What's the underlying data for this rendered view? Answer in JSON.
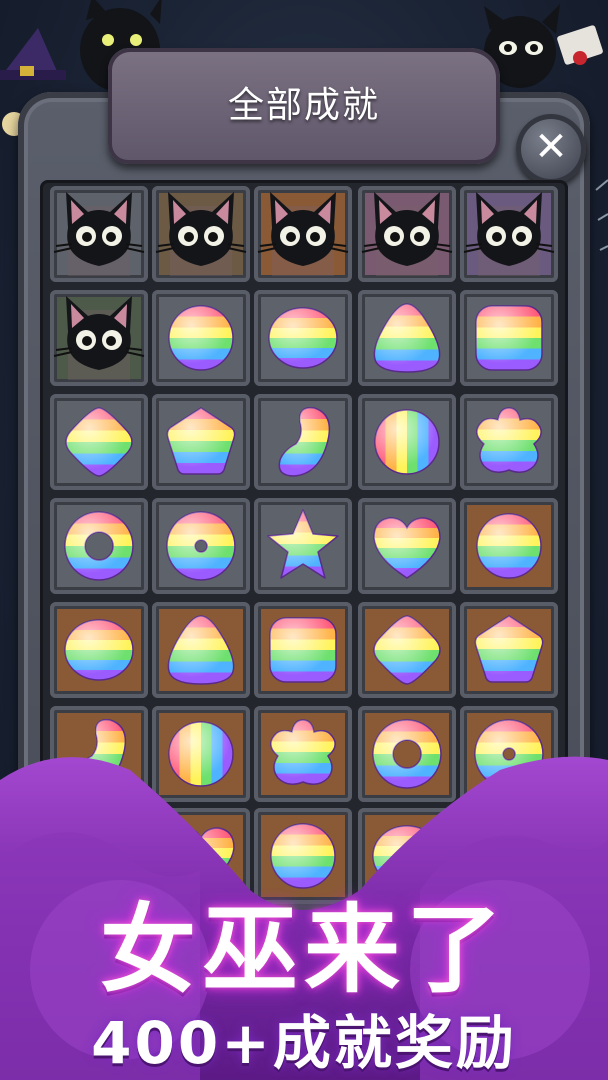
{
  "header": {
    "title": "全部成就",
    "close_label": "✕"
  },
  "banner": {
    "title": "女巫来了",
    "subtitle": "400+成就奖励"
  },
  "colors": {
    "tile_gray": "#5d626b",
    "tile_brown": "#8a5a36",
    "tile_pink": "#7a5a70",
    "tile_purple": "#6a5a80",
    "tile_green": "#4d5a4a",
    "mist_purple": "#8b3ab8"
  },
  "grid": {
    "rows": [
      [
        {
          "item": "cat-icon",
          "bg": "gray"
        },
        {
          "item": "cat-icon",
          "bg": "brown-dim"
        },
        {
          "item": "cat-icon",
          "bg": "brown"
        },
        {
          "item": "cat-icon",
          "bg": "pink"
        },
        {
          "item": "cat-icon",
          "bg": "purple"
        }
      ],
      [
        {
          "item": "cat-icon",
          "bg": "green"
        },
        {
          "item": "rainbow-ball-icon",
          "bg": "gray"
        },
        {
          "item": "rainbow-oval-icon",
          "bg": "gray"
        },
        {
          "item": "rainbow-triangle-icon",
          "bg": "gray"
        },
        {
          "item": "rainbow-square-icon",
          "bg": "gray"
        }
      ],
      [
        {
          "item": "rainbow-diamond-icon",
          "bg": "gray"
        },
        {
          "item": "rainbow-pentagon-icon",
          "bg": "gray"
        },
        {
          "item": "rainbow-moon-icon",
          "bg": "gray"
        },
        {
          "item": "rainbow-vertical-ball-icon",
          "bg": "gray"
        },
        {
          "item": "rainbow-flower-icon",
          "bg": "gray"
        }
      ],
      [
        {
          "item": "rainbow-ring-icon",
          "bg": "gray"
        },
        {
          "item": "rainbow-donut-icon",
          "bg": "gray"
        },
        {
          "item": "rainbow-star-icon",
          "bg": "gray"
        },
        {
          "item": "rainbow-heart-icon",
          "bg": "gray"
        },
        {
          "item": "rainbow-ball-icon",
          "bg": "brown"
        }
      ],
      [
        {
          "item": "rainbow-oval-icon",
          "bg": "brown"
        },
        {
          "item": "rainbow-triangle-icon",
          "bg": "brown"
        },
        {
          "item": "rainbow-square-icon",
          "bg": "brown"
        },
        {
          "item": "rainbow-diamond-icon",
          "bg": "brown"
        },
        {
          "item": "rainbow-pentagon-icon",
          "bg": "brown"
        }
      ],
      [
        {
          "item": "rainbow-moon-icon",
          "bg": "brown"
        },
        {
          "item": "rainbow-vertical-ball-icon",
          "bg": "brown"
        },
        {
          "item": "rainbow-flower-icon",
          "bg": "brown"
        },
        {
          "item": "rainbow-ring-icon",
          "bg": "brown"
        },
        {
          "item": "rainbow-donut-icon",
          "bg": "brown"
        }
      ],
      [
        {
          "item": "",
          "bg": "gray"
        },
        {
          "item": "rainbow-heart-icon",
          "bg": "brown"
        },
        {
          "item": "rainbow-ball-icon",
          "bg": "brown"
        },
        {
          "item": "rainbow-oval-icon",
          "bg": "brown"
        },
        {
          "item": "",
          "bg": "gray"
        }
      ]
    ]
  }
}
